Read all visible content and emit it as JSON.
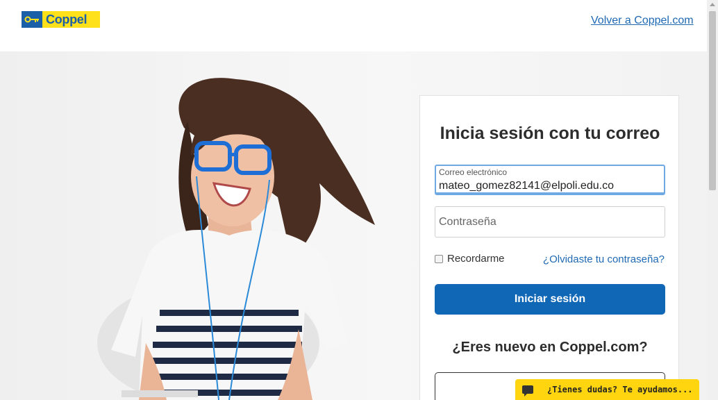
{
  "header": {
    "brand": "Coppel",
    "back_link": "Volver a Coppel.com"
  },
  "login": {
    "title": "Inicia sesión con tu correo",
    "email_label": "Correo electrónico",
    "email_value": "mateo_gomez82141@elpoli.edu.co",
    "password_placeholder": "Contraseña",
    "remember_label": "Recordarme",
    "remember_checked": false,
    "forgot_link": "¿Olvidaste tu contraseña?",
    "submit_label": "Iniciar sesión",
    "new_user_title": "¿Eres nuevo en Coppel.com?"
  },
  "chat": {
    "label": "¿Tienes dudas? Te ayudamos..."
  },
  "colors": {
    "brand_blue": "#1067b6",
    "brand_yellow": "#ffe11b",
    "link": "#1f69b4",
    "chat_yellow": "#ffd510"
  }
}
